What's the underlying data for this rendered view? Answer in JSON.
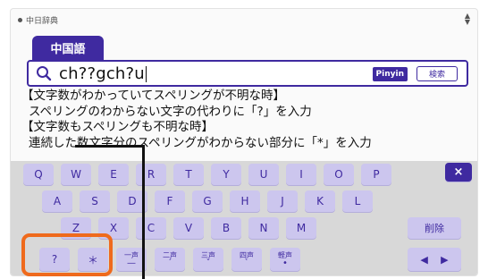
{
  "app": {
    "dictionary_name": "中日辞典",
    "scroll_arrows": "▲\n▼"
  },
  "tab": {
    "label": "中国語"
  },
  "search": {
    "value": "ch??gch?u",
    "pinyin_label": "Pinyin",
    "search_label": "検索"
  },
  "help_lines": [
    "【文字数がわかっていてスペリングが不明な時】",
    "スペリングのわからない文字の代わりに「?」を入力",
    "【文字数もスペリングも不明な時】",
    "連続した数文字分のスペリングがわからない部分に「*」を入力"
  ],
  "keyboard": {
    "row1": [
      "Q",
      "W",
      "E",
      "R",
      "T",
      "Y",
      "U",
      "I",
      "O",
      "P"
    ],
    "row2": [
      "A",
      "S",
      "D",
      "F",
      "G",
      "H",
      "J",
      "K",
      "L"
    ],
    "row3": [
      "Z",
      "X",
      "C",
      "V",
      "B",
      "N",
      "M"
    ],
    "close": "×",
    "delete": "削除",
    "wildcard_question": "?",
    "wildcard_star": "＊",
    "tones": [
      {
        "label": "一声",
        "mark": "—"
      },
      {
        "label": "二声",
        "mark": "ˊ"
      },
      {
        "label": "三声",
        "mark": "ˇ"
      },
      {
        "label": "四声",
        "mark": "ˋ"
      },
      {
        "label": "軽声",
        "mark": "•"
      }
    ],
    "arrow_left": "◀",
    "arrow_right": "▶"
  },
  "colors": {
    "accent": "#3f2aa0",
    "key": "#ccc6ee",
    "highlight": "#ef6a1c"
  }
}
